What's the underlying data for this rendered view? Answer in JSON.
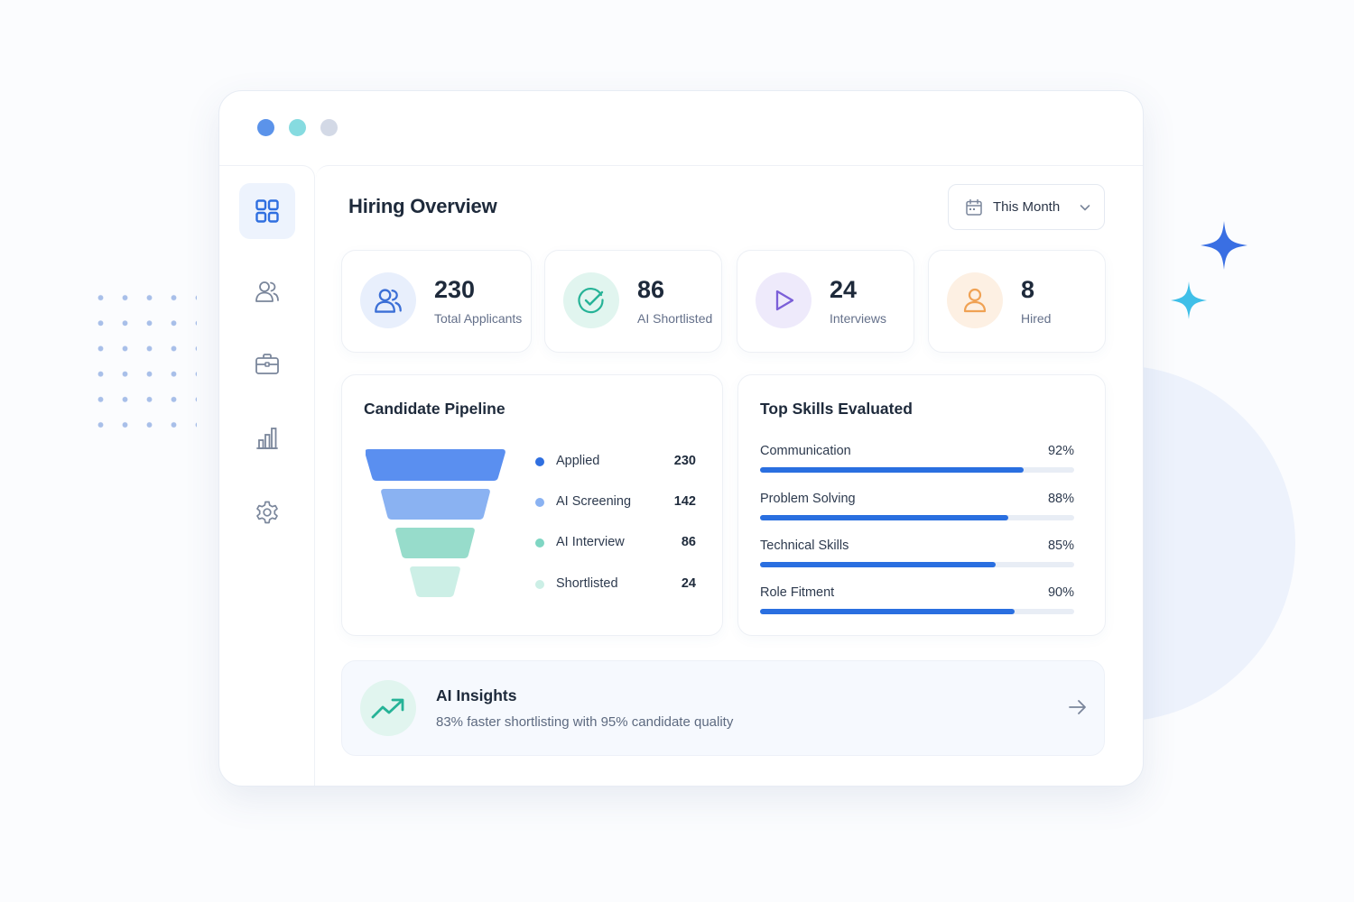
{
  "window": {
    "controls": [
      {
        "name": "control-dot-blue",
        "color": "#5b93ea"
      },
      {
        "name": "control-dot-teal",
        "color": "#86dbe0"
      },
      {
        "name": "control-dot-gray",
        "color": "#d3d9e6"
      }
    ]
  },
  "sidebar": {
    "items": [
      {
        "icon": "dashboard-grid-icon",
        "active": true
      },
      {
        "icon": "users-icon",
        "active": false
      },
      {
        "icon": "briefcase-icon",
        "active": false
      },
      {
        "icon": "bar-chart-icon",
        "active": false
      },
      {
        "icon": "settings-gear-icon",
        "active": false
      }
    ]
  },
  "header": {
    "title": "Hiring Overview",
    "period_label": "This Month",
    "period_icon": "calendar-icon"
  },
  "stats": [
    {
      "value": "230",
      "label": "Total Applicants",
      "icon": "users-icon",
      "color": "#3b6fd6",
      "bg": "#e8effc"
    },
    {
      "value": "86",
      "label": "AI Shortlisted",
      "icon": "check-circle-icon",
      "color": "#26b397",
      "bg": "#e1f5ef"
    },
    {
      "value": "24",
      "label": "Interviews",
      "icon": "play-icon",
      "color": "#7b5fd8",
      "bg": "#eeeafb"
    },
    {
      "value": "8",
      "label": "Hired",
      "icon": "user-icon",
      "color": "#f0a254",
      "bg": "#fdf0e3"
    }
  ],
  "pipeline": {
    "title": "Candidate Pipeline",
    "stages": [
      {
        "name": "Applied",
        "value": "230",
        "color": "#5a8ff0"
      },
      {
        "name": "AI Screening",
        "value": "142",
        "color": "#8ab2f2"
      },
      {
        "name": "AI Interview",
        "value": "86",
        "color": "#97dccb"
      },
      {
        "name": "Shortlisted",
        "value": "24",
        "color": "#ccefe6"
      }
    ]
  },
  "skills": {
    "title": "Top Skills Evaluated",
    "items": [
      {
        "name": "Communication",
        "percent_label": "92%",
        "percent": 84
      },
      {
        "name": "Problem Solving",
        "percent_label": "88%",
        "percent": 79
      },
      {
        "name": "Technical Skills",
        "percent_label": "85%",
        "percent": 75
      },
      {
        "name": "Role Fitment",
        "percent_label": "90%",
        "percent": 81
      }
    ],
    "bar_color": "#2a6fe0"
  },
  "insights": {
    "title": "AI Insights",
    "text": "83% faster shortlisting with 95% candidate quality",
    "icon": "trending-up-icon",
    "arrow_icon": "arrow-right-icon"
  }
}
